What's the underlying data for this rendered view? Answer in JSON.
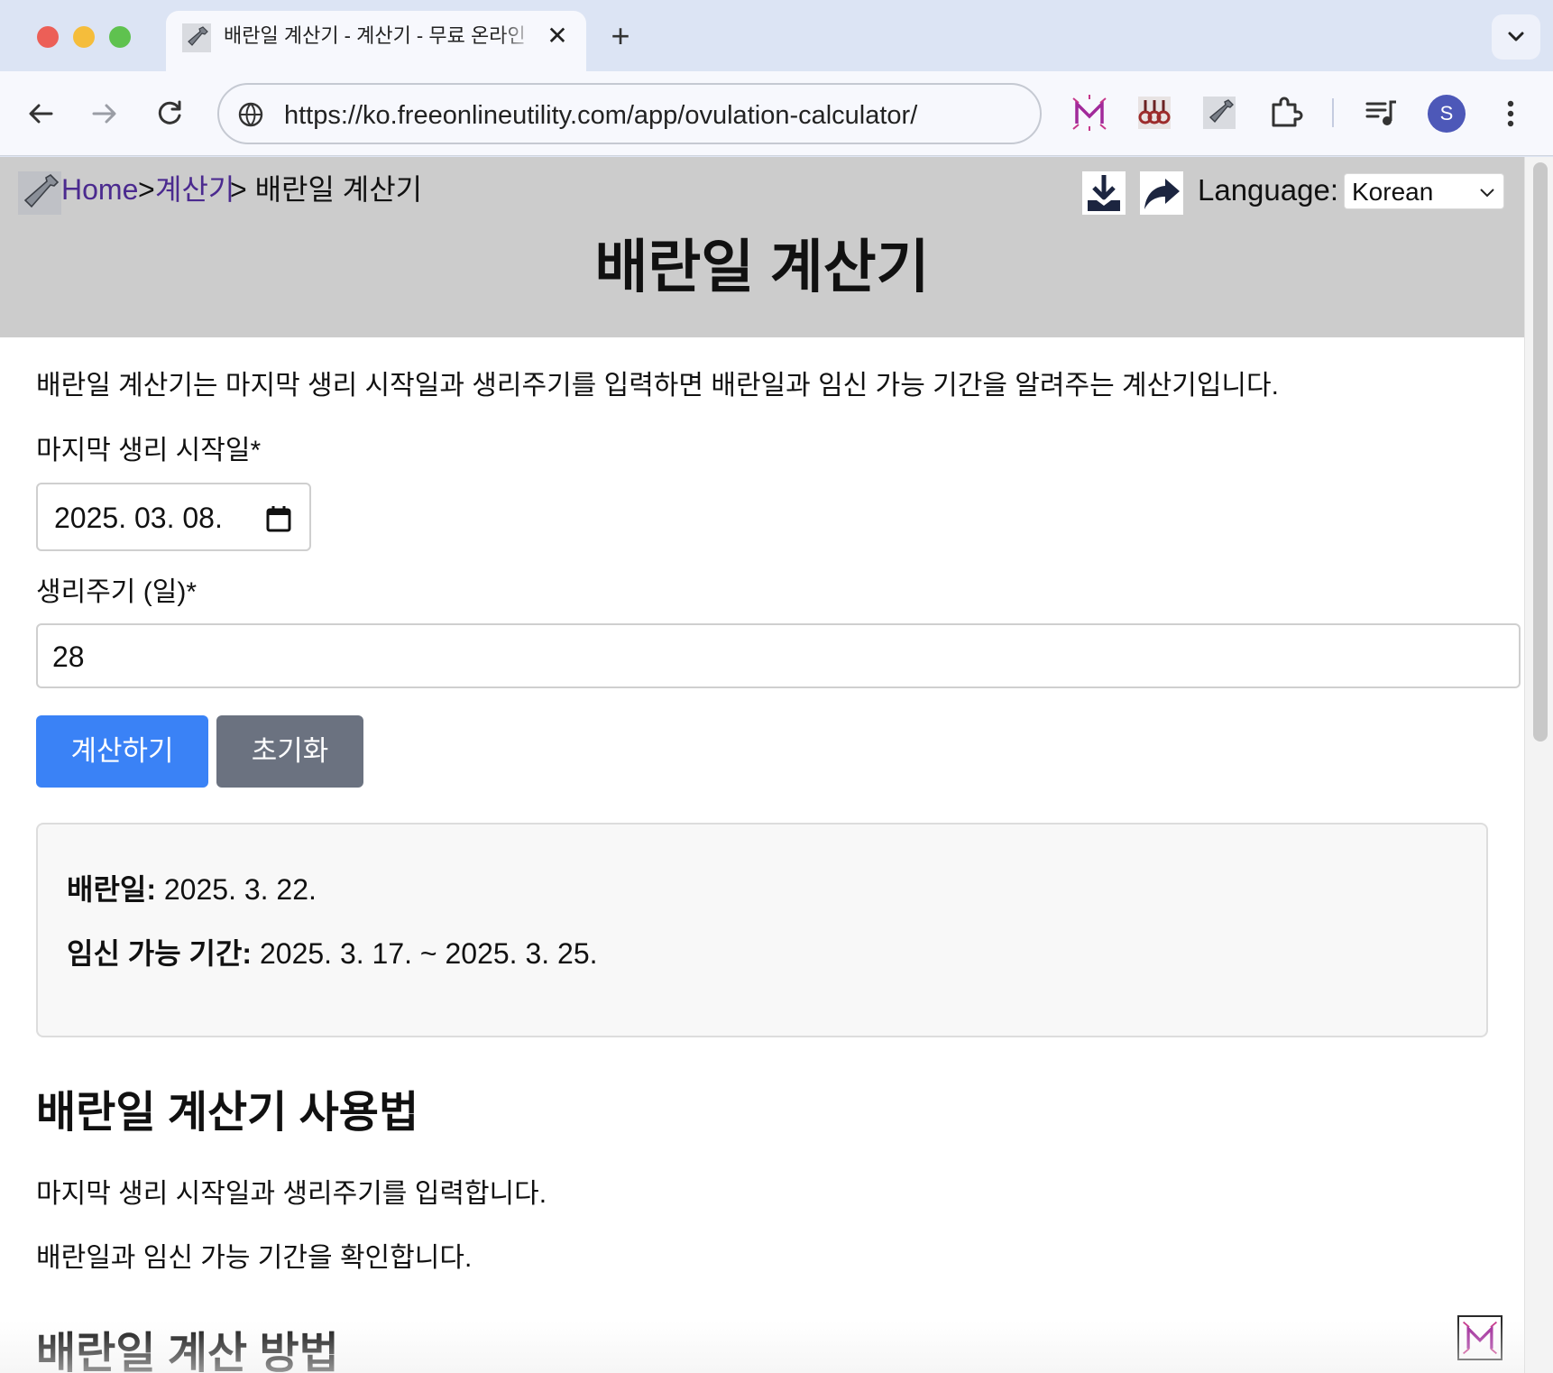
{
  "browser": {
    "tab_title": "배란일 계산기 - 계산기 - 무료 온라인",
    "tab_close": "✕",
    "new_tab": "+",
    "url": "https://ko.freeonlineutility.com/app/ovulation-calculator/",
    "profile_initial": "S"
  },
  "breadcrumb": {
    "home": "Home",
    "sep1": ">",
    "category": "계산기",
    "current": "> 배란일 계산기"
  },
  "header": {
    "language_label": "Language:",
    "language_value": "Korean",
    "title": "배란일 계산기"
  },
  "main": {
    "intro": "배란일 계산기는 마지막 생리 시작일과 생리주기를 입력하면 배란일과 임신 가능 기간을 알려주는 계산기입니다.",
    "last_period_label": "마지막 생리 시작일*",
    "last_period_value": "2025. 03. 08.",
    "cycle_label": "생리주기 (일)*",
    "cycle_value": "28",
    "calculate_label": "계산하기",
    "reset_label": "초기화"
  },
  "result": {
    "ovulation_label": "배란일:",
    "ovulation_value": " 2025. 3. 22.",
    "fertile_label": "임신 가능 기간:",
    "fertile_value": " 2025. 3. 17. ~ 2025. 3. 25."
  },
  "howto": {
    "heading": "배란일 계산기 사용법",
    "step1": "마지막 생리 시작일과 생리주기를 입력합니다.",
    "step2": "배란일과 임신 가능 기간을 확인합니다."
  },
  "method": {
    "heading": "배란일 계산 방법"
  },
  "colors": {
    "primary_button": "#3a82f6",
    "secondary_button": "#6b7280",
    "header_bg": "#cccccc",
    "link": "#4b2a8f"
  }
}
